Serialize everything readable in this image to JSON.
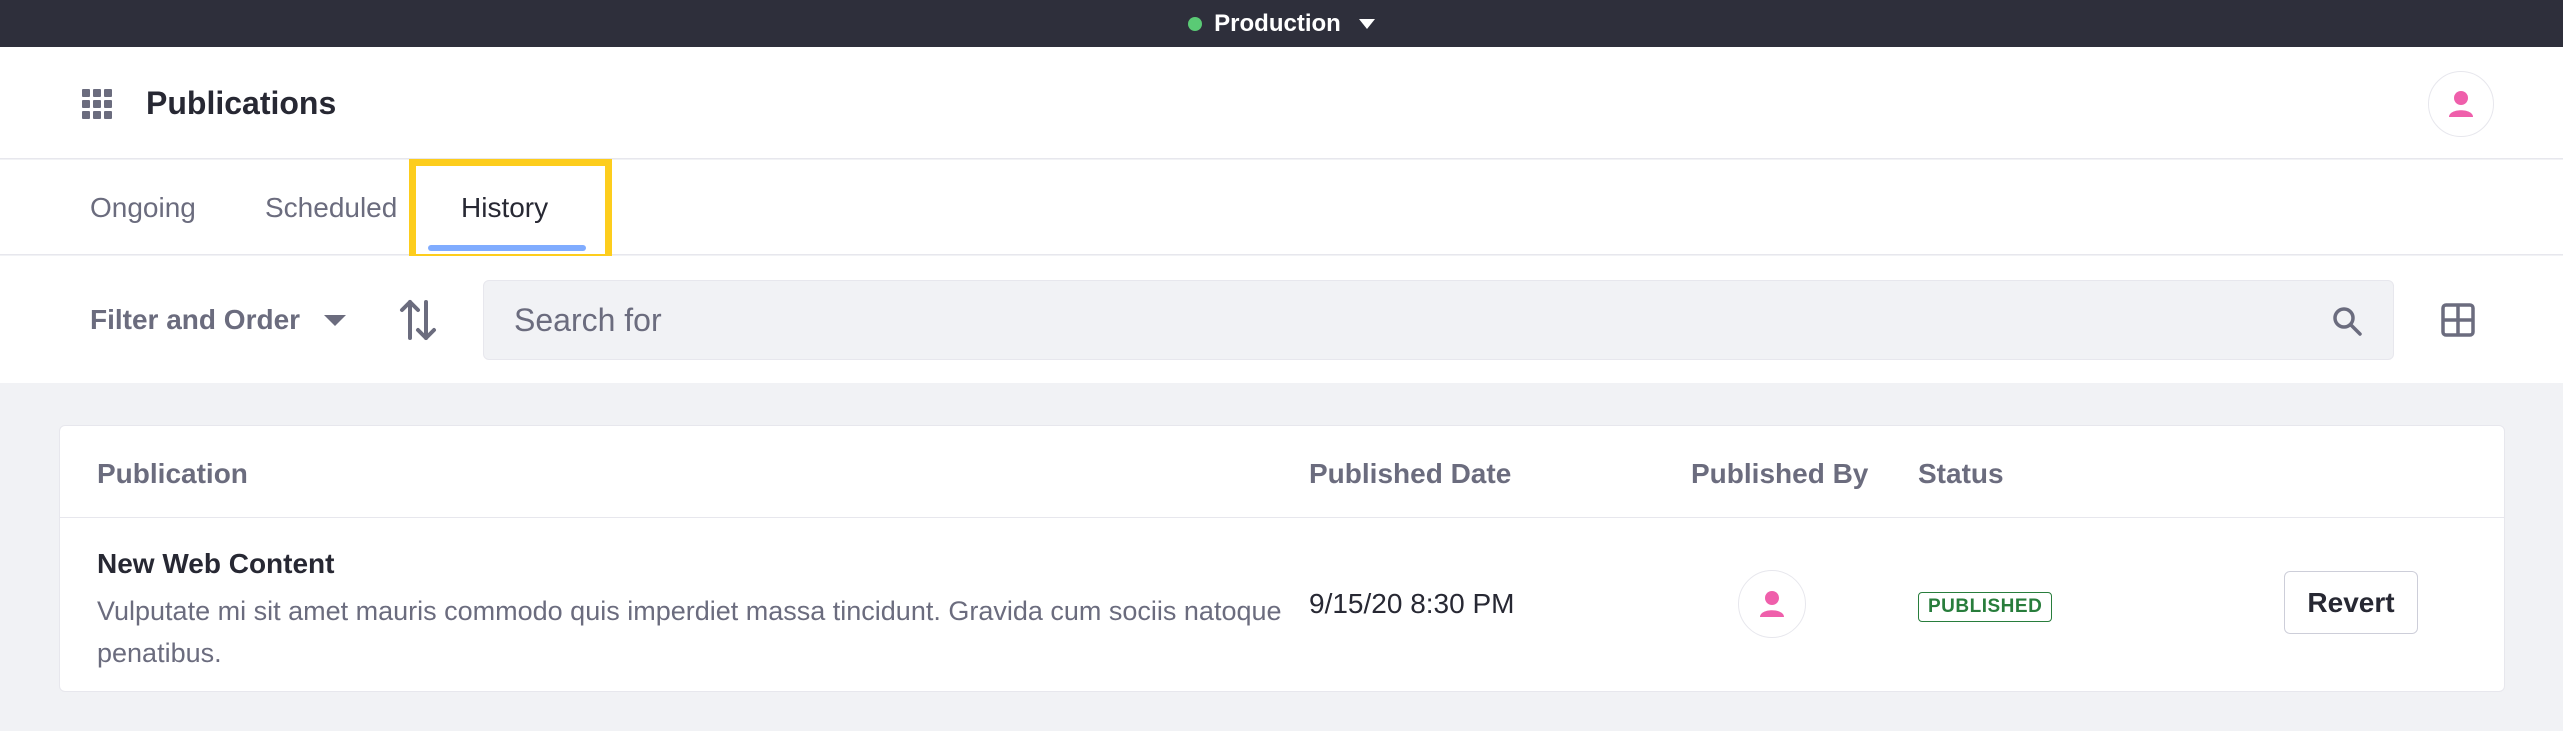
{
  "env_bar": {
    "label": "Production",
    "status_color": "#5aca75"
  },
  "header": {
    "title": "Publications",
    "apps_icon": "grid-dots-icon",
    "user_icon": "user-icon"
  },
  "tabs": [
    {
      "label": "Ongoing",
      "active": false
    },
    {
      "label": "Scheduled",
      "active": false
    },
    {
      "label": "History",
      "active": true
    }
  ],
  "toolbar": {
    "filter_label": "Filter and Order",
    "sort_icon": "sort-arrows-icon",
    "search_placeholder": "Search for",
    "search_icon": "search-icon",
    "view_icon": "cards-view-icon"
  },
  "table": {
    "columns": [
      "Publication",
      "Published Date",
      "Published By",
      "Status"
    ],
    "rows": [
      {
        "name": "New Web Content",
        "description": "Vulputate mi sit amet mauris commodo quis imperdiet massa tincidunt. Gravida cum sociis natoque penatibus.",
        "published_date": "9/15/20 8:30 PM",
        "published_by_icon": "user-icon",
        "status": "PUBLISHED",
        "action_label": "Revert"
      }
    ]
  },
  "colors": {
    "accent_underline": "#80acff",
    "highlight_frame": "#fdcd1d",
    "status_published": "#287d3c",
    "user_icon": "#ef5fab"
  }
}
